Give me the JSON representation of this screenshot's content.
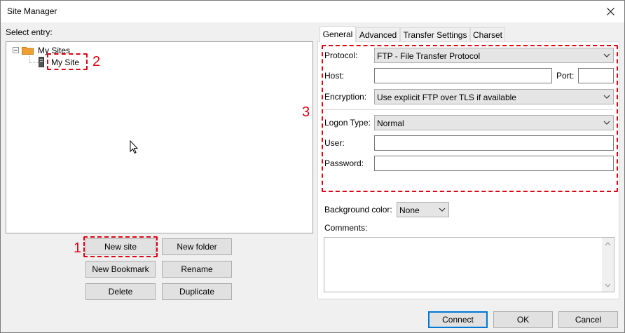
{
  "window": {
    "title": "Site Manager"
  },
  "left": {
    "select_entry_label": "Select entry:",
    "tree": {
      "root_label": "My Sites",
      "site_label": "My Site"
    },
    "buttons": {
      "new_site": "New site",
      "new_folder": "New folder",
      "new_bookmark": "New Bookmark",
      "rename": "Rename",
      "delete": "Delete",
      "duplicate": "Duplicate"
    }
  },
  "tabs": [
    {
      "label": "General",
      "active": true
    },
    {
      "label": "Advanced"
    },
    {
      "label": "Transfer Settings"
    },
    {
      "label": "Charset"
    }
  ],
  "general": {
    "protocol_label": "Protocol:",
    "protocol_value": "FTP - File Transfer Protocol",
    "host_label": "Host:",
    "host_value": "",
    "port_label": "Port:",
    "port_value": "",
    "encryption_label": "Encryption:",
    "encryption_value": "Use explicit FTP over TLS if available",
    "logon_type_label": "Logon Type:",
    "logon_type_value": "Normal",
    "user_label": "User:",
    "user_value": "",
    "password_label": "Password:",
    "password_value": "",
    "background_color_label": "Background color:",
    "background_color_value": "None",
    "comments_label": "Comments:"
  },
  "annotations": {
    "one": "1",
    "two": "2",
    "three": "3"
  },
  "footer": {
    "connect": "Connect",
    "ok": "OK",
    "cancel": "Cancel"
  },
  "colors": {
    "annotation": "#e0000f",
    "default_button_border": "#0078d7",
    "folder": "#f0a030"
  },
  "icons": [
    "close-icon",
    "collapse-icon",
    "folder-icon",
    "server-icon",
    "chevron-down-icon",
    "mouse-pointer-icon",
    "scroll-up-icon",
    "scroll-down-icon"
  ]
}
